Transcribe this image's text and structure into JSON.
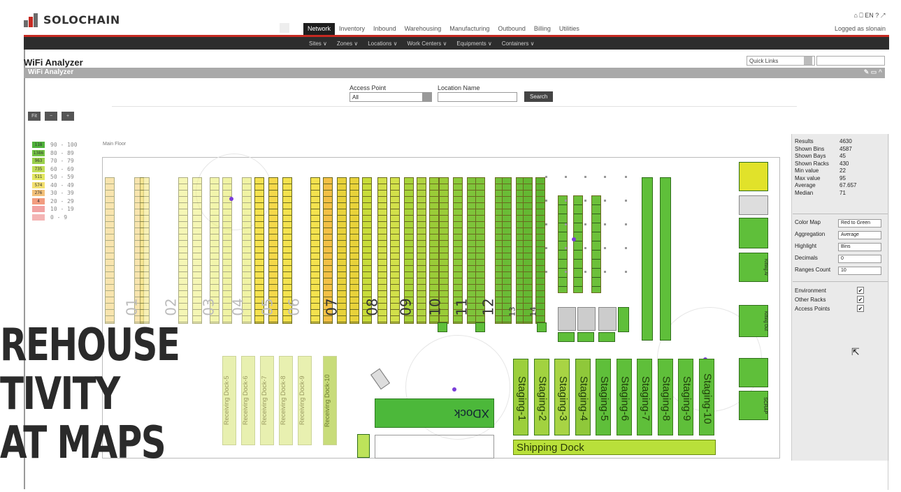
{
  "app": {
    "logo_text": "SOLOCHAIN",
    "page_title": "WiFi Analyzer",
    "panel_title": "WiFi Analyzer",
    "logged_as": "Logged as slonain",
    "top_icons": "⌂ ⎕ EN ? ↗"
  },
  "main_nav": [
    "Network",
    "Inventory",
    "Inbound",
    "Warehousing",
    "Manufacturing",
    "Outbound",
    "Billing",
    "Utilities"
  ],
  "sub_nav": [
    "Sites ∨",
    "Zones ∨",
    "Locations ∨",
    "Work Centers ∨",
    "Equipments ∨",
    "Containers ∨"
  ],
  "quick_links": {
    "label": "Quick Links"
  },
  "filters": {
    "access_point_label": "Access Point",
    "access_point_value": "All",
    "location_name_label": "Location Name",
    "search_label": "Search"
  },
  "zoom_buttons": [
    "Fit",
    "−",
    "+"
  ],
  "legend": [
    {
      "count": "118",
      "range": "90 - 100",
      "color": "#4fb23a"
    },
    {
      "count": "1386",
      "range": "80 - 89",
      "color": "#74c444"
    },
    {
      "count": "963",
      "range": "70 - 79",
      "color": "#9ad04c"
    },
    {
      "count": "735",
      "range": "60 - 69",
      "color": "#c3de58"
    },
    {
      "count": "511",
      "range": "50 - 59",
      "color": "#e3e760"
    },
    {
      "count": "574",
      "range": "40 - 49",
      "color": "#f3e070"
    },
    {
      "count": "276",
      "range": "30 - 39",
      "color": "#f3c17a"
    },
    {
      "count": "4",
      "range": "20 - 29",
      "color": "#f29c7f"
    },
    {
      "count": "",
      "range": "10 - 19",
      "color": "#f2a3a3"
    },
    {
      "count": "",
      "range": "0 - 9",
      "color": "#f4b4b4"
    }
  ],
  "floor_label": "Main Floor",
  "aisles": [
    "01",
    "02",
    "03",
    "04",
    "05",
    "06",
    "07",
    "08",
    "09",
    "10",
    "11",
    "12",
    "13",
    "14"
  ],
  "staging": [
    "Staging-1",
    "Staging-2",
    "Staging-3",
    "Staging-4",
    "Staging-5",
    "Staging-6",
    "Staging-7",
    "Staging-8",
    "Staging-9",
    "Staging-10"
  ],
  "receiving": [
    "Receiving Dock-5",
    "Receiving Dock-6",
    "Receiving Dock-7",
    "Receiving Dock-8",
    "Receiving Dock-9",
    "Receiving Dock-10"
  ],
  "shipping_dock": "Shipping Dock",
  "xdock": "XDock",
  "side_labels": [
    "Kitting Ar",
    "Kitting Out",
    "SCRAP"
  ],
  "stats": [
    {
      "label": "Results",
      "value": "4630"
    },
    {
      "label": "Shown Bins",
      "value": "4587"
    },
    {
      "label": "Shown Bays",
      "value": "45"
    },
    {
      "label": "Shown Racks",
      "value": "430"
    },
    {
      "label": "Min value",
      "value": "22"
    },
    {
      "label": "Max value",
      "value": "95"
    },
    {
      "label": "Average",
      "value": "67.657"
    },
    {
      "label": "Median",
      "value": "71"
    }
  ],
  "options": [
    {
      "label": "Color Map",
      "value": "Red to Green"
    },
    {
      "label": "Aggregation",
      "value": "Average"
    },
    {
      "label": "Highlight",
      "value": "Bins"
    },
    {
      "label": "Decimals",
      "value": "0"
    },
    {
      "label": "Ranges Count",
      "value": "10"
    }
  ],
  "toggles": [
    {
      "label": "Environment",
      "checked": true
    },
    {
      "label": "Other Racks",
      "checked": true
    },
    {
      "label": "Access Points",
      "checked": true
    }
  ],
  "overlay_lines": [
    "REHOUSE",
    "TIVITY",
    "AT MAPS"
  ]
}
